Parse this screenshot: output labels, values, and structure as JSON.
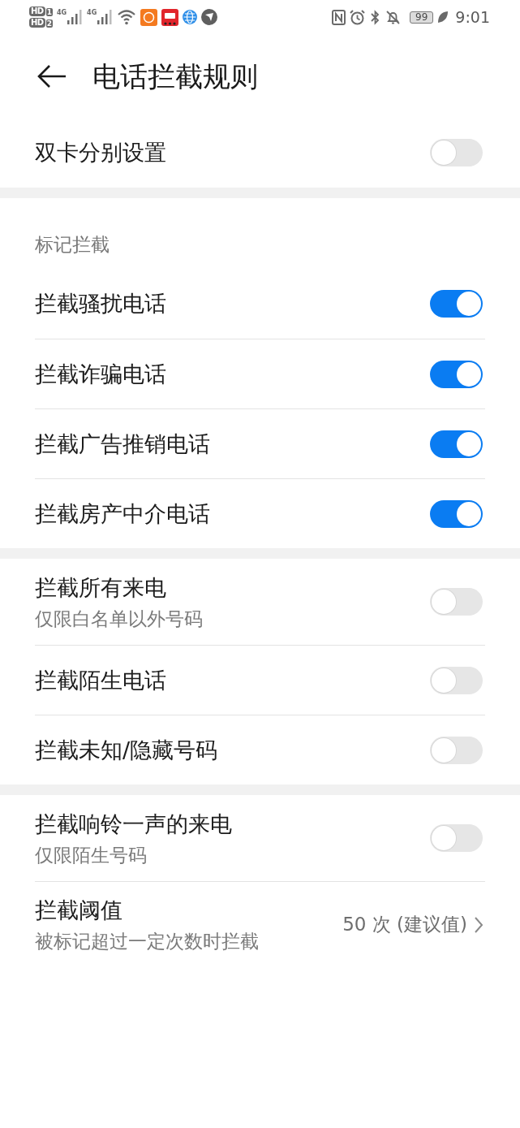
{
  "status_bar": {
    "sims": [
      {
        "badge": "HD",
        "slot": "1"
      },
      {
        "badge": "HD",
        "slot": "2"
      }
    ],
    "signals": [
      {
        "network": "4G"
      },
      {
        "network": "4G"
      }
    ],
    "battery": "99",
    "time": "9:01"
  },
  "header": {
    "title": "电话拦截规则"
  },
  "groups": [
    {
      "rows": [
        {
          "kind": "toggle",
          "label": "双卡分别设置",
          "on": false
        }
      ]
    },
    {
      "title": "标记拦截",
      "rows": [
        {
          "kind": "toggle",
          "label": "拦截骚扰电话",
          "on": true
        },
        {
          "kind": "toggle",
          "label": "拦截诈骗电话",
          "on": true
        },
        {
          "kind": "toggle",
          "label": "拦截广告推销电话",
          "on": true
        },
        {
          "kind": "toggle",
          "label": "拦截房产中介电话",
          "on": true
        }
      ]
    },
    {
      "rows": [
        {
          "kind": "toggle",
          "label": "拦截所有来电",
          "sublabel": "仅限白名单以外号码",
          "on": false
        },
        {
          "kind": "toggle",
          "label": "拦截陌生电话",
          "on": false
        },
        {
          "kind": "toggle",
          "label": "拦截未知/隐藏号码",
          "on": false
        }
      ]
    },
    {
      "rows": [
        {
          "kind": "toggle",
          "label": "拦截响铃一声的来电",
          "sublabel": "仅限陌生号码",
          "on": false
        },
        {
          "kind": "value",
          "label": "拦截阈值",
          "sublabel": "被标记超过一定次数时拦截",
          "value": "50 次 (建议值)"
        }
      ]
    }
  ]
}
